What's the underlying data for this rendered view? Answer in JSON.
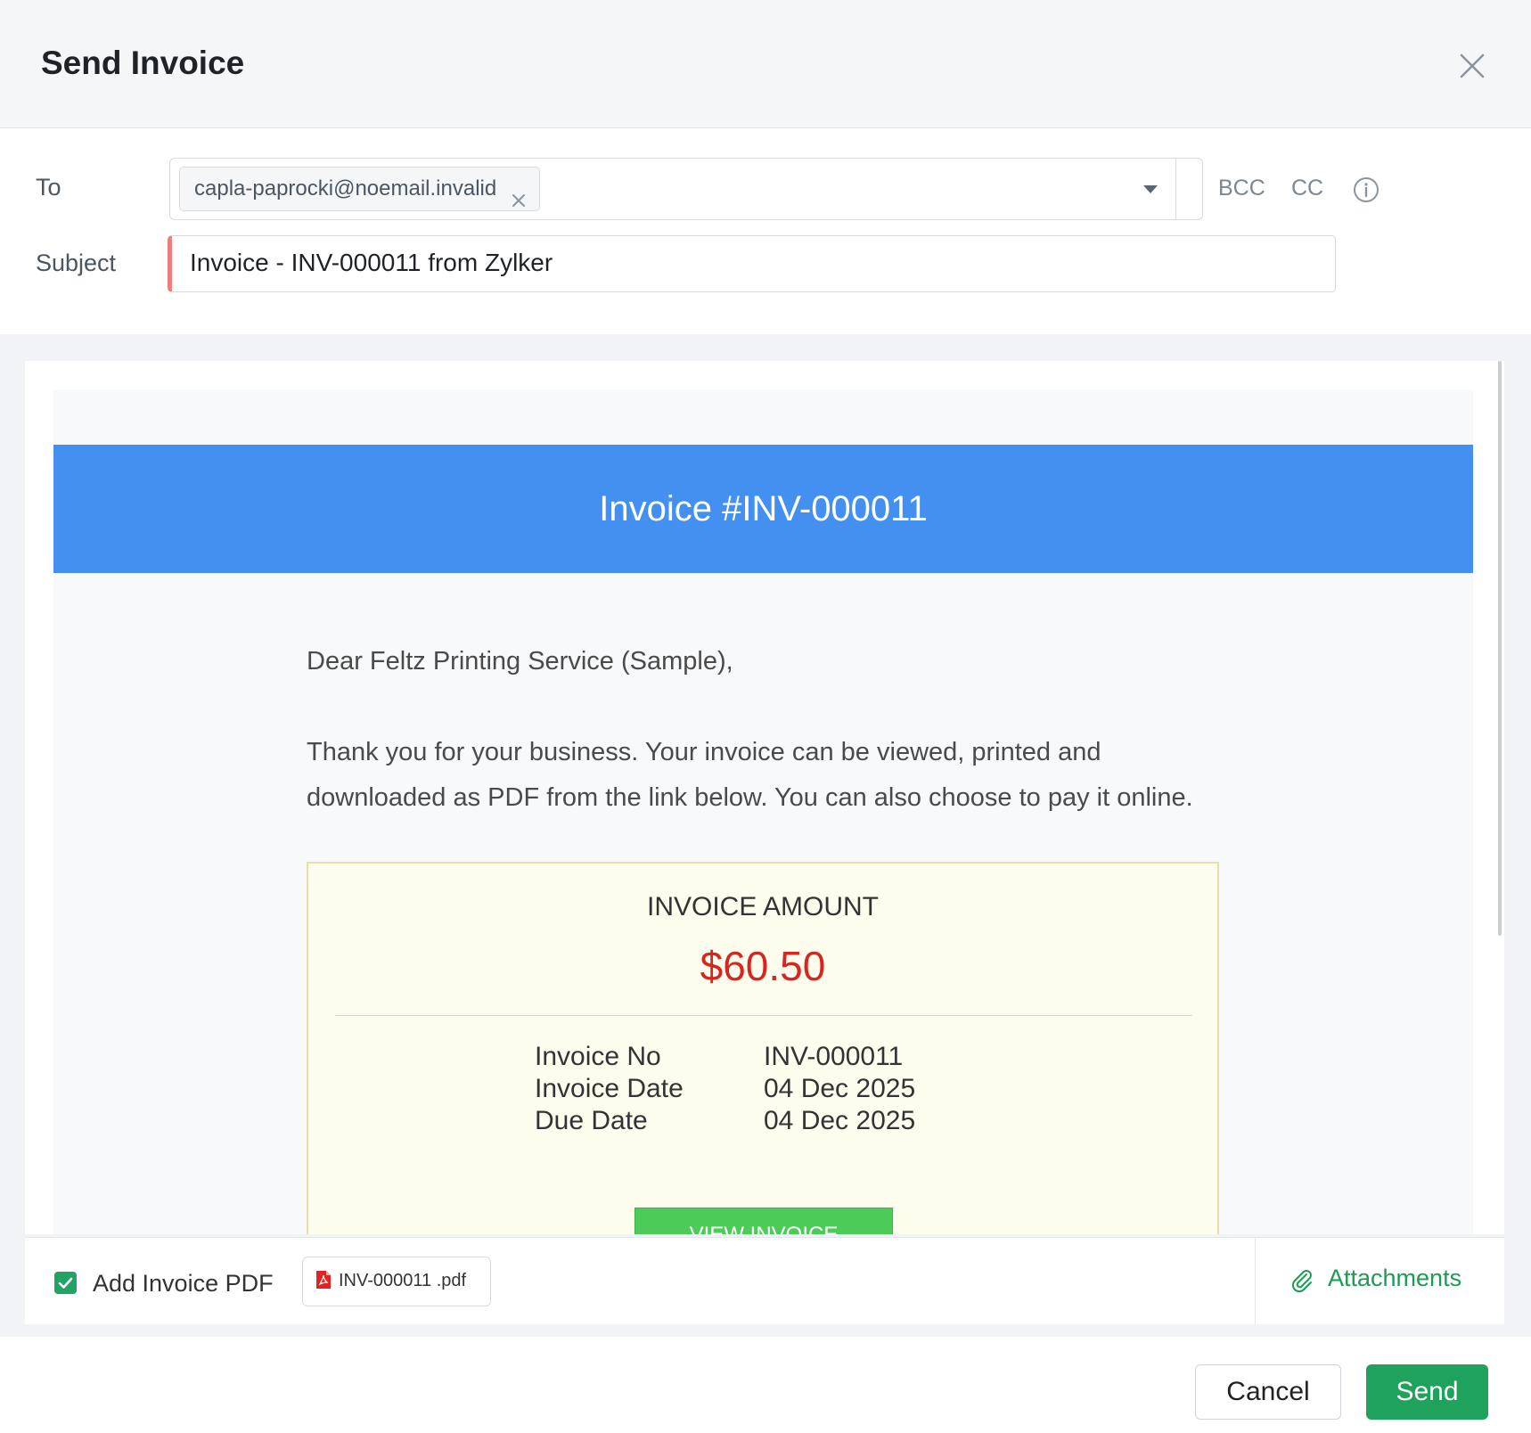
{
  "dialog": {
    "title": "Send Invoice"
  },
  "form": {
    "to_label": "To",
    "recipient_email": "capla-paprocki@noemail.invalid",
    "bcc_label": "BCC",
    "cc_label": "CC",
    "subject_label": "Subject",
    "subject_value": "Invoice - INV-000011 from Zylker"
  },
  "email": {
    "banner_title": "Invoice #INV-000011",
    "greeting": "Dear Feltz Printing Service (Sample),",
    "body_line1": "Thank you for your business. Your invoice can be viewed, printed and",
    "body_line2": "downloaded as PDF from the link below. You can also choose to pay it online.",
    "amount_title": "INVOICE AMOUNT",
    "amount_value": "$60.50",
    "details": [
      {
        "label": "Invoice No",
        "value": "INV-000011"
      },
      {
        "label": "Invoice Date",
        "value": "04 Dec 2025"
      },
      {
        "label": "Due Date",
        "value": "04 Dec 2025"
      }
    ],
    "view_button_label": "VIEW INVOICE"
  },
  "attachments": {
    "add_pdf_label": "Add Invoice PDF",
    "add_pdf_checked": true,
    "pdf_filename": "INV-000011 .pdf",
    "attachments_label": "Attachments"
  },
  "footer": {
    "cancel_label": "Cancel",
    "send_label": "Send"
  },
  "colors": {
    "banner": "#4490f0",
    "amount": "#d7261f",
    "primary": "#1fa35c",
    "view_button": "#4ccb58"
  }
}
